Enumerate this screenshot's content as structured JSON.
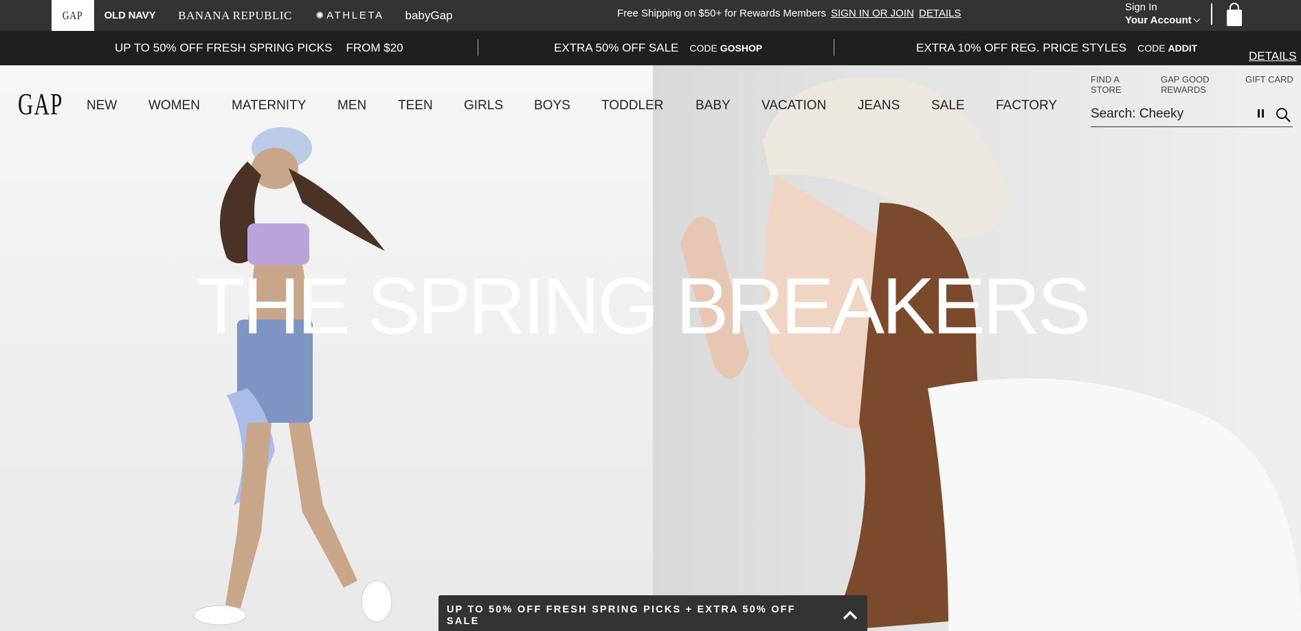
{
  "brand_bar": {
    "brands": {
      "gap": "GAP",
      "old_navy": "OLD NAVY",
      "banana_republic": "BANANA REPUBLIC",
      "athleta": "ATHLETA",
      "baby_gap": "babyGap"
    },
    "shipping_message": "Free Shipping on $50+ for Rewards Members",
    "sign_in_link": "SIGN IN OR JOIN",
    "details_link": "DETAILS",
    "account": {
      "sign_in": "Sign In",
      "label": "Your Account"
    },
    "icons": [
      "chevron-down-icon",
      "shopping-bag-icon"
    ]
  },
  "promo_bar": {
    "promos": [
      {
        "main": "UP TO 50% OFF FRESH SPRING PICKS",
        "extra": "FROM $20"
      },
      {
        "main": "EXTRA 50% OFF SALE",
        "code_label": "CODE",
        "code": "GOSHOP"
      },
      {
        "main": "EXTRA 10% OFF REG. PRICE STYLES",
        "code_label": "CODE",
        "code": "ADDIT"
      }
    ],
    "details_link": "DETAILS"
  },
  "nav": {
    "logo": "GAP",
    "items": [
      "NEW",
      "WOMEN",
      "MATERNITY",
      "MEN",
      "TEEN",
      "GIRLS",
      "BOYS",
      "TODDLER",
      "BABY",
      "VACATION",
      "JEANS",
      "SALE",
      "FACTORY"
    ],
    "utility": {
      "find_store": [
        "FIND A",
        "STORE"
      ],
      "rewards": [
        "GAP GOOD",
        "REWARDS"
      ],
      "gift_card": "GIFT CARD"
    },
    "search": {
      "placeholder": "Search: Cheeky",
      "icons": [
        "pause-icon",
        "search-icon"
      ]
    }
  },
  "hero": {
    "title": "THE SPRING BREAKERS"
  },
  "sticky_promo": {
    "text": "UP TO 50% OFF FRESH SPRING PICKS + EXTRA 50% OFF SALE",
    "icon": "chevron-up-icon"
  },
  "colors": {
    "top_bar": "#333333",
    "promo_bar": "#1f1f1f",
    "hero_text": "#ffffff"
  }
}
